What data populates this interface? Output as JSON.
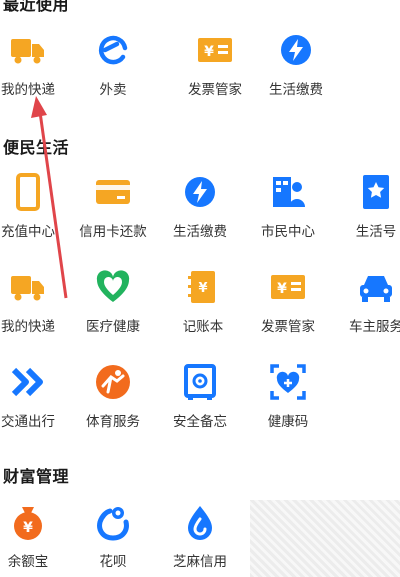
{
  "sections": {
    "recent": {
      "title": "最近使用"
    },
    "life": {
      "title": "便民生活"
    },
    "wealth": {
      "title": "财富管理"
    }
  },
  "recent": [
    {
      "label": "我的快递",
      "icon": "delivery-truck-icon"
    },
    {
      "label": "外卖",
      "icon": "e-delivery-icon"
    },
    {
      "label": "发票管家",
      "icon": "invoice-icon"
    },
    {
      "label": "生活缴费",
      "icon": "utility-payment-icon"
    }
  ],
  "life": [
    {
      "label": "充值中心",
      "icon": "phone-recharge-icon"
    },
    {
      "label": "信用卡还款",
      "icon": "credit-card-icon"
    },
    {
      "label": "生活缴费",
      "icon": "utility-payment-icon"
    },
    {
      "label": "市民中心",
      "icon": "citizen-center-icon"
    },
    {
      "label": "生活号",
      "icon": "life-account-icon"
    },
    {
      "label": "我的快递",
      "icon": "delivery-truck-icon"
    },
    {
      "label": "医疗健康",
      "icon": "medical-health-icon"
    },
    {
      "label": "记账本",
      "icon": "ledger-icon"
    },
    {
      "label": "发票管家",
      "icon": "invoice-icon"
    },
    {
      "label": "车主服务",
      "icon": "car-service-icon"
    },
    {
      "label": "交通出行",
      "icon": "transport-icon"
    },
    {
      "label": "体育服务",
      "icon": "sports-icon"
    },
    {
      "label": "安全备忘",
      "icon": "safe-memo-icon"
    },
    {
      "label": "健康码",
      "icon": "health-code-icon"
    }
  ],
  "wealth": [
    {
      "label": "余额宝",
      "icon": "yuebao-icon"
    },
    {
      "label": "花呗",
      "icon": "huabei-icon"
    },
    {
      "label": "芝麻信用",
      "icon": "sesame-credit-icon"
    }
  ],
  "colors": {
    "orange": "#f5a623",
    "blue": "#1677ff",
    "green": "#22b35e",
    "red": "#e0454a"
  }
}
